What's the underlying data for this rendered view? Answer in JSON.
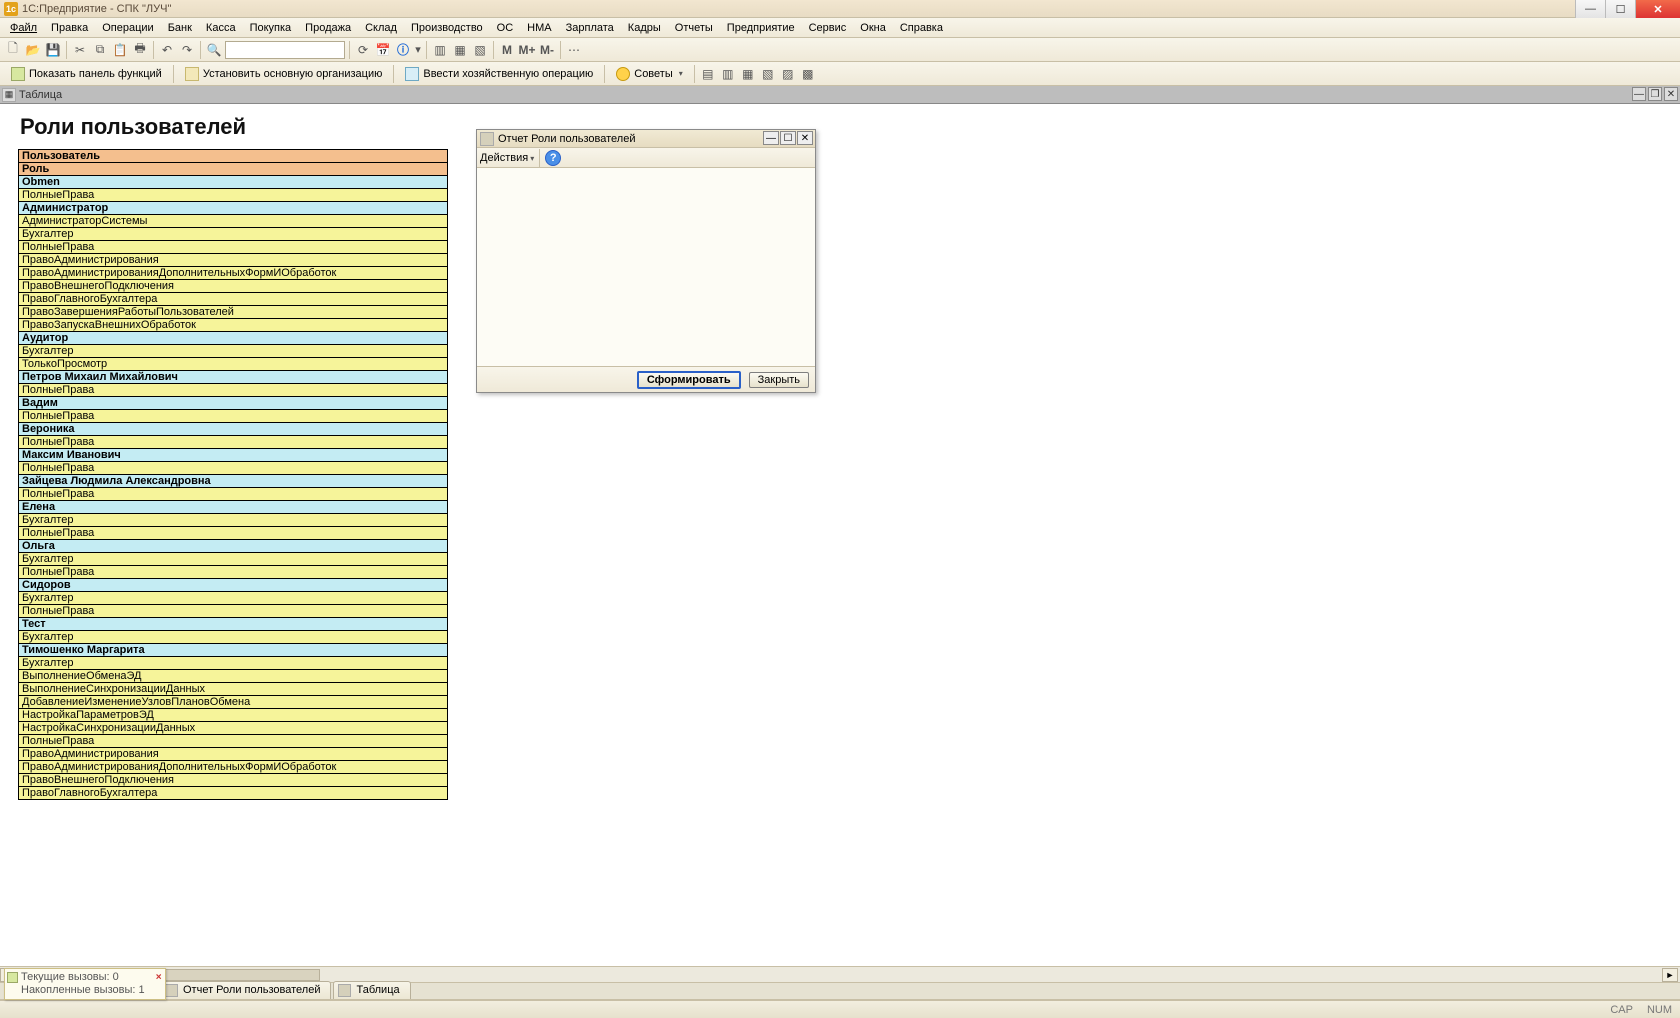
{
  "title_bar": "1С:Предприятие - СПК \"ЛУЧ\"",
  "menus": [
    "Файл",
    "Правка",
    "Операции",
    "Банк",
    "Касса",
    "Покупка",
    "Продажа",
    "Склад",
    "Производство",
    "ОС",
    "НМА",
    "Зарплата",
    "Кадры",
    "Отчеты",
    "Предприятие",
    "Сервис",
    "Окна",
    "Справка"
  ],
  "toolbar2": {
    "btn1": "Показать панель функций",
    "btn2": "Установить основную организацию",
    "btn3": "Ввести хозяйственную операцию",
    "btn4": "Советы"
  },
  "doc_tab": "Таблица",
  "report": {
    "title": "Роли пользователей",
    "header1": "Пользователь",
    "header2": "Роль",
    "groups": [
      {
        "user": "Obmen",
        "roles": [
          "ПолныеПрава"
        ]
      },
      {
        "user": "Администратор",
        "roles": [
          "АдминистраторСистемы",
          "Бухгалтер",
          "ПолныеПрава",
          "ПравоАдминистрирования",
          "ПравоАдминистрированияДополнительныхФормИОбработок",
          "ПравоВнешнегоПодключения",
          "ПравоГлавногоБухгалтера",
          "ПравоЗавершенияРаботыПользователей",
          "ПравоЗапускаВнешнихОбработок"
        ]
      },
      {
        "user": "Аудитор",
        "roles": [
          "Бухгалтер",
          "ТолькоПросмотр"
        ]
      },
      {
        "user": "Петров Михаил Михайлович",
        "roles": [
          "ПолныеПрава"
        ]
      },
      {
        "user": "Вадим",
        "roles": [
          "ПолныеПрава"
        ]
      },
      {
        "user": "Вероника",
        "roles": [
          "ПолныеПрава"
        ]
      },
      {
        "user": "Максим Иванович",
        "roles": [
          "ПолныеПрава"
        ]
      },
      {
        "user": "Зайцева Людмила Александровна",
        "roles": [
          "ПолныеПрава"
        ]
      },
      {
        "user": "Елена",
        "roles": [
          "Бухгалтер",
          "ПолныеПрава"
        ]
      },
      {
        "user": "Ольга",
        "roles": [
          "Бухгалтер",
          "ПолныеПрава"
        ]
      },
      {
        "user": "Сидоров",
        "roles": [
          "Бухгалтер",
          "ПолныеПрава"
        ]
      },
      {
        "user": "Тест",
        "roles": [
          "Бухгалтер"
        ]
      },
      {
        "user": "Тимошенко Маргарита",
        "roles": [
          "Бухгалтер",
          "ВыполнениеОбменаЭД",
          "ВыполнениеСинхронизацииДанных",
          "ДобавлениеИзменениеУзловПлановОбмена",
          "НастройкаПараметровЭД",
          "НастройкаСинхронизацииДанных",
          "ПолныеПрава",
          "ПравоАдминистрирования",
          "ПравоАдминистрированияДополнительныхФормИОбработок",
          "ПравоВнешнегоПодключения",
          "ПравоГлавногоБухгалтера"
        ]
      }
    ]
  },
  "dialog": {
    "title": "Отчет  Роли пользователей",
    "actions": "Действия",
    "ok": "Сформировать",
    "close": "Закрыть"
  },
  "wintabs": [
    "Отчет  Роли пользователей",
    "Таблица"
  ],
  "status_popup": {
    "line1": "Текущие вызовы: 0",
    "line2": "Накопленные вызовы: 1"
  },
  "statusbar": {
    "cap": "CAP",
    "num": "NUM"
  }
}
